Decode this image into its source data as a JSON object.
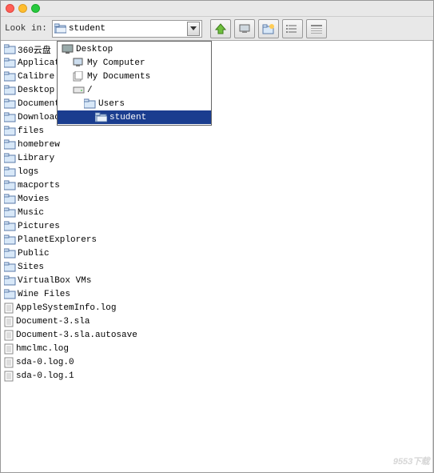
{
  "toolbar": {
    "look_in_label": "Look in:",
    "look_in_value": "student"
  },
  "dropdown": {
    "items": [
      {
        "label": "Desktop",
        "depth": 0,
        "icon": "desktop"
      },
      {
        "label": "My Computer",
        "depth": 1,
        "icon": "computer"
      },
      {
        "label": "My Documents",
        "depth": 1,
        "icon": "documents"
      },
      {
        "label": "/",
        "depth": 1,
        "icon": "drive"
      },
      {
        "label": "Users",
        "depth": 2,
        "icon": "folder"
      },
      {
        "label": "student",
        "depth": 3,
        "icon": "folder-open",
        "selected": true
      }
    ]
  },
  "files": [
    {
      "name": "360云盘",
      "type": "folder"
    },
    {
      "name": "Applicat",
      "type": "folder"
    },
    {
      "name": "Calibre",
      "type": "folder"
    },
    {
      "name": "Desktop",
      "type": "folder"
    },
    {
      "name": "Document",
      "type": "folder"
    },
    {
      "name": "Download",
      "type": "folder"
    },
    {
      "name": "files",
      "type": "folder"
    },
    {
      "name": "homebrew",
      "type": "folder"
    },
    {
      "name": "Library",
      "type": "folder"
    },
    {
      "name": "logs",
      "type": "folder"
    },
    {
      "name": "macports",
      "type": "folder"
    },
    {
      "name": "Movies",
      "type": "folder"
    },
    {
      "name": "Music",
      "type": "folder"
    },
    {
      "name": "Pictures",
      "type": "folder"
    },
    {
      "name": "PlanetExplorers",
      "type": "folder"
    },
    {
      "name": "Public",
      "type": "folder"
    },
    {
      "name": "Sites",
      "type": "folder"
    },
    {
      "name": "VirtualBox VMs",
      "type": "folder"
    },
    {
      "name": "Wine Files",
      "type": "folder"
    },
    {
      "name": "AppleSystemInfo.log",
      "type": "file"
    },
    {
      "name": "Document-3.sla",
      "type": "file"
    },
    {
      "name": "Document-3.sla.autosave",
      "type": "file"
    },
    {
      "name": "hmclmc.log",
      "type": "file"
    },
    {
      "name": "sda-0.log.0",
      "type": "file"
    },
    {
      "name": "sda-0.log.1",
      "type": "file"
    }
  ],
  "watermark": "9553下载"
}
